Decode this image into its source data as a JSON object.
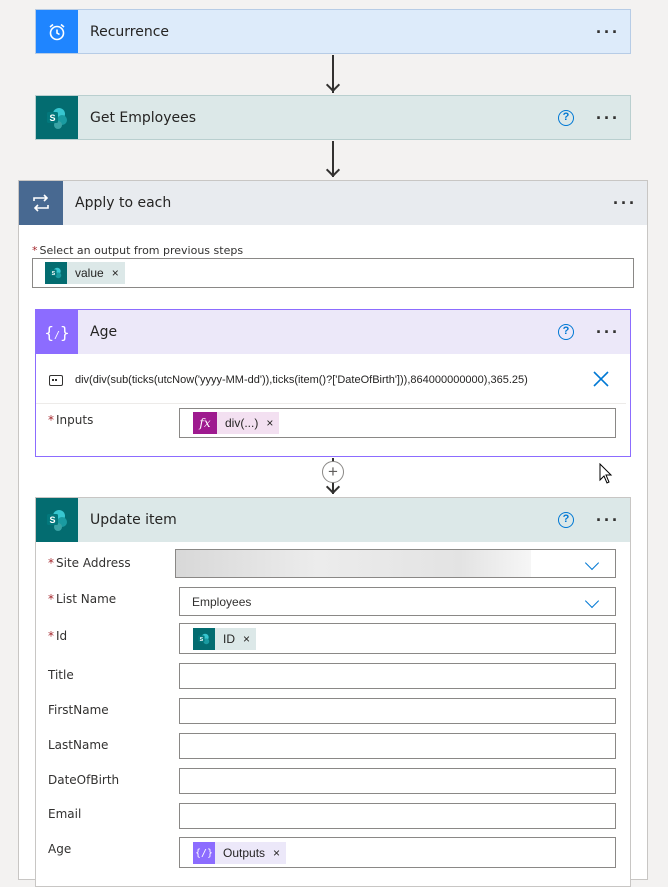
{
  "recurrence": {
    "title": "Recurrence",
    "more": "···"
  },
  "get_employees": {
    "title": "Get Employees",
    "help": "?",
    "more": "···"
  },
  "apply_each": {
    "title": "Apply to each",
    "more": "···",
    "select_label": "Select an output from previous steps",
    "token": "value",
    "token_remove": "×"
  },
  "age": {
    "title": "Age",
    "help": "?",
    "more": "···",
    "expression": "div(div(sub(ticks(utcNow('yyyy-MM-dd')),ticks(item()?['DateOfBirth'])),864000000000),365.25)",
    "inputs_label": "Inputs",
    "inputs_token": "div(...)",
    "token_remove": "×",
    "fx_icon": "fx"
  },
  "add_step": "+",
  "update_item": {
    "title": "Update item",
    "help": "?",
    "more": "···",
    "fields": {
      "site_address": {
        "label": "Site Address",
        "value": ""
      },
      "list_name": {
        "label": "List Name",
        "value": "Employees"
      },
      "id": {
        "label": "Id",
        "token": "ID"
      },
      "title": {
        "label": "Title",
        "value": ""
      },
      "firstname": {
        "label": "FirstName",
        "value": ""
      },
      "lastname": {
        "label": "LastName",
        "value": ""
      },
      "dob": {
        "label": "DateOfBirth",
        "value": ""
      },
      "email": {
        "label": "Email",
        "value": ""
      },
      "age": {
        "label": "Age",
        "token": "Outputs"
      }
    },
    "token_remove": "×",
    "required_mark": "*"
  },
  "colors": {
    "recurrence_bg": "#ddebfa",
    "recurrence_icon": "#1f85ff",
    "sharepoint_bg": "#dce8e8",
    "sharepoint_icon": "#036c70",
    "apply_bg": "#e8ebef",
    "apply_icon": "#486991",
    "compose_bg": "#ece8f9",
    "compose_icon": "#8c6cff",
    "compose_border": "#8c6cff",
    "expression_token": "#9e1a8f"
  }
}
